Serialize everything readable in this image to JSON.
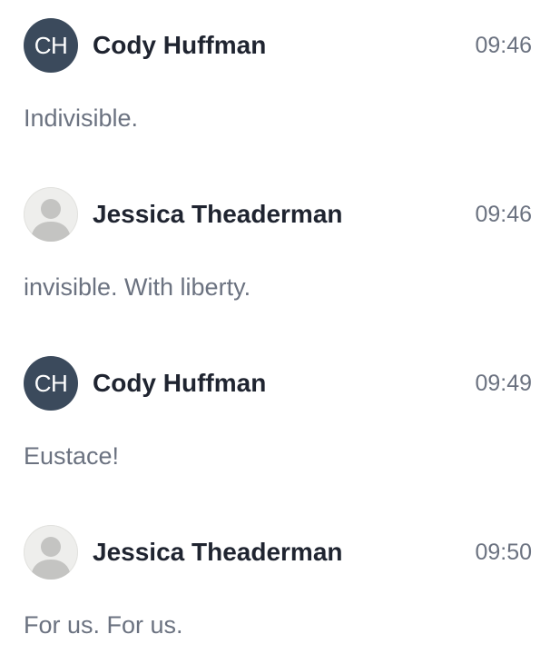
{
  "colors": {
    "avatar_initials_bg": "#3b4a5c",
    "avatar_placeholder_bg": "#eeeeec",
    "sender_name": "#1f2430",
    "message_text": "#6b7280",
    "timestamp": "#6b7280"
  },
  "messages": [
    {
      "sender": "Cody Huffman",
      "avatar_type": "initials",
      "initials": "CH",
      "time": "09:46",
      "text": "Indivisible."
    },
    {
      "sender": "Jessica Theaderman",
      "avatar_type": "placeholder",
      "avatar_icon": "default-user-icon",
      "time": "09:46",
      "text": "invisible. With liberty."
    },
    {
      "sender": "Cody Huffman",
      "avatar_type": "initials",
      "initials": "CH",
      "time": "09:49",
      "text": "Eustace!"
    },
    {
      "sender": "Jessica Theaderman",
      "avatar_type": "placeholder",
      "avatar_icon": "default-user-icon",
      "time": "09:50",
      "text": "For us. For us."
    }
  ]
}
